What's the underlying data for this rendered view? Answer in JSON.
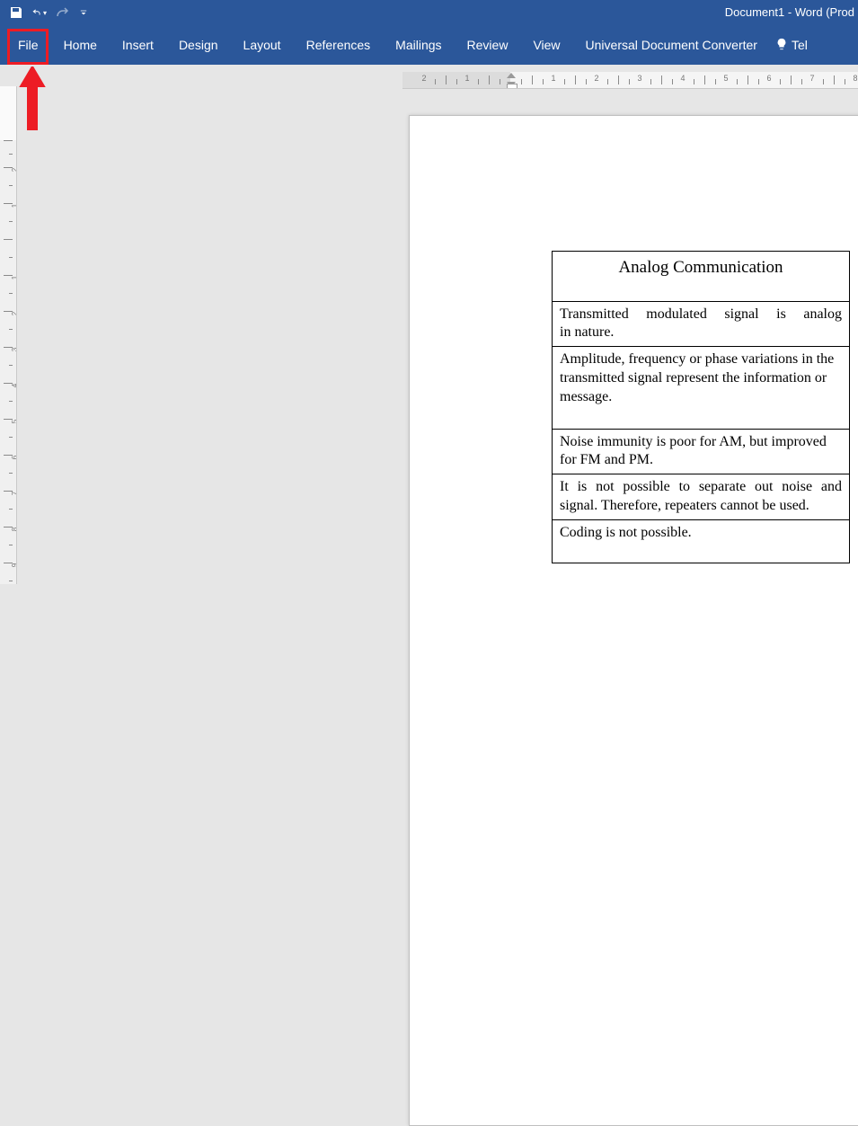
{
  "titlebar": {
    "app_title": "Document1 - Word (Prod"
  },
  "ribbon": {
    "tabs": {
      "file": "File",
      "home": "Home",
      "insert": "Insert",
      "design": "Design",
      "layout": "Layout",
      "references": "References",
      "mailings": "Mailings",
      "review": "Review",
      "view": "View",
      "udc": "Universal Document Converter"
    },
    "tell_me": "Tel"
  },
  "document": {
    "table": {
      "header": "Analog Communication",
      "rows": [
        "Transmitted modulated signal is analog in nature.",
        "Amplitude, frequency or phase variations in the transmitted signal represent the information or message.",
        "Noise immunity is poor for AM, but improved for FM and PM.",
        "It is not possible to separate out noise and signal. Therefore, repeaters cannot be used.",
        "Coding is not possible."
      ]
    }
  },
  "hruler": {
    "left_numbers": [
      "2",
      "1"
    ],
    "right_numbers": [
      "1",
      "2",
      "3",
      "4",
      "5",
      "6",
      "7",
      "8"
    ]
  }
}
